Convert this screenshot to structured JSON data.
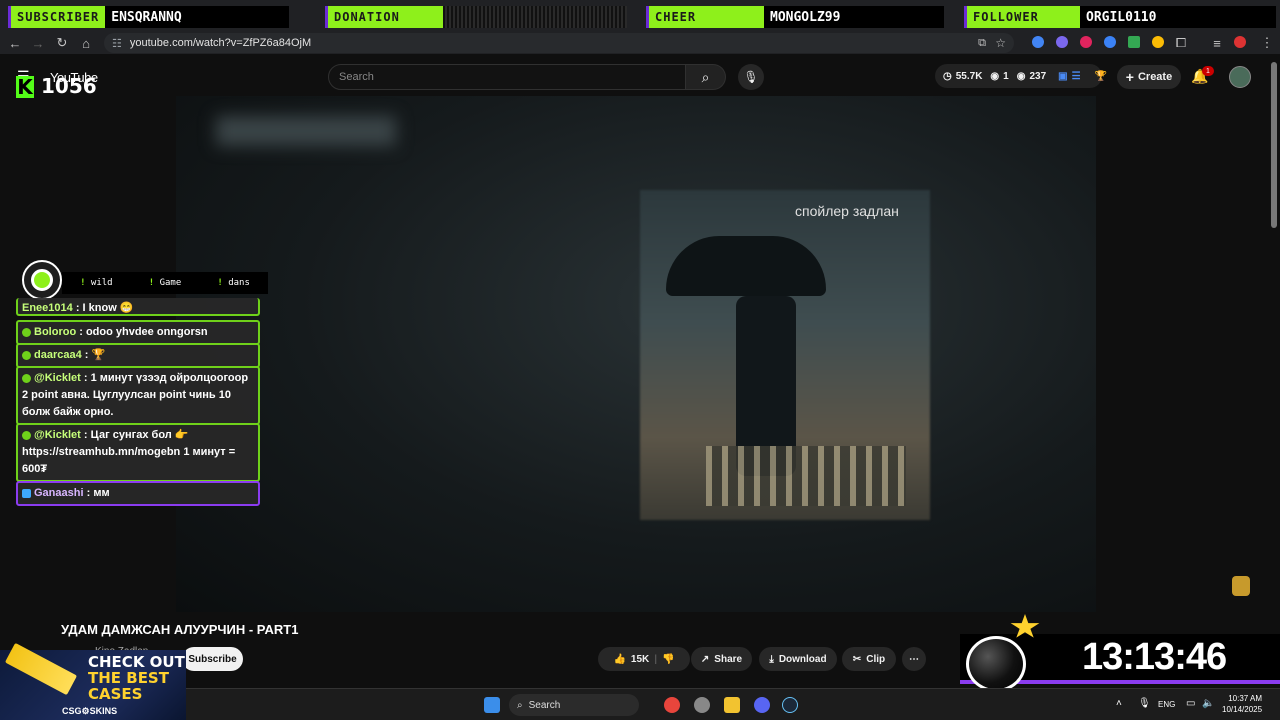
{
  "alerts": {
    "subscriber_label": "SUBSCRIBER",
    "subscriber_name": "ENSQRANNQ",
    "donation_label": "DONATION",
    "cheer_label": "CHEER",
    "cheer_name": "MONGOLZ99",
    "follower_label": "FOLLOWER",
    "follower_name": "ORGIL0110"
  },
  "browser": {
    "url": "youtube.com/watch?v=ZfPZ6a84OjM"
  },
  "youtube": {
    "logo_text": "YouTube",
    "search_placeholder": "Search",
    "stats_views": "55.7K",
    "stats_a": "1",
    "stats_b": "237",
    "create_label": "Create",
    "notif_count": "1"
  },
  "kick": {
    "viewer_count": "1056"
  },
  "video": {
    "subtitle": "спойлер задлан",
    "title": "УДАМ ДАМЖСАН АЛУУРЧИН - PART1",
    "channel": "Kino Zadlan",
    "subscribe_label": "Subscribe",
    "likes": "15K",
    "share_label": "Share",
    "download_label": "Download",
    "clip_label": "Clip"
  },
  "chat": {
    "tabs": [
      "wild",
      "Game",
      "dans"
    ],
    "messages": [
      {
        "user": "Enee1014",
        "text": ": I know 😁"
      },
      {
        "user": "Boloroo",
        "text": ": odoo yhvdee onngorsn"
      },
      {
        "user": "daarcaa4",
        "text": ": 🏆"
      },
      {
        "user": "@Kicklet",
        "text": ": 1 минут үзээд ойролцоогоор 2 point авна. Цуглуулсан point чинь 10 болж байж орно."
      },
      {
        "user": "@Kicklet",
        "text": ": Цаг сунгах бол 👉 https://streamhub.mn/mogebn 1 минут = 600₮"
      },
      {
        "user": "Ganaashi",
        "text": ": мм"
      }
    ]
  },
  "ad": {
    "line1": "CHECK OUT",
    "line2": "THE BEST",
    "line3": "CASES",
    "brand": "CSG⚙SKINS"
  },
  "timer": {
    "value": "13:13:46"
  },
  "taskbar": {
    "search_label": "Search",
    "lang": "ENG",
    "time": "10:37 AM",
    "date": "10/14/2025"
  }
}
